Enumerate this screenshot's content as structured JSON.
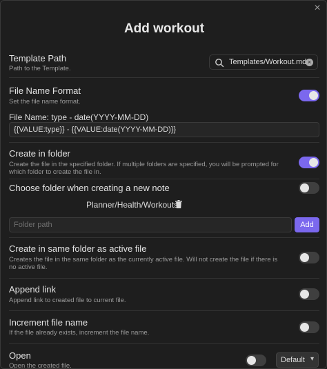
{
  "modal": {
    "title": "Add workout"
  },
  "template_path": {
    "title": "Template Path",
    "desc": "Path to the Template.",
    "value": "Templates/Workout.md"
  },
  "file_name_format": {
    "title": "File Name Format",
    "desc": "Set the file name format.",
    "enabled": true,
    "preview_label": "File Name: type - date(YYYY-MM-DD)",
    "value": "{{VALUE:type}} - {{VALUE:date(YYYY-MM-DD)}}"
  },
  "create_in_folder": {
    "title": "Create in folder",
    "desc_line1": "Create the file in the specified folder. If multiple folders are specified, you will be prompted for",
    "desc_line2": "which folder to create the file in.",
    "enabled": true
  },
  "choose_folder": {
    "title": "Choose folder when creating a new note",
    "enabled": false,
    "folders": [
      "Planner/Health/Workouts"
    ],
    "input_placeholder": "Folder path",
    "add_label": "Add"
  },
  "same_folder": {
    "title": "Create in same folder as active file",
    "desc_line1": "Creates the file in the same folder as the currently active file. Will not create the file if there is",
    "desc_line2": "no active file.",
    "enabled": false
  },
  "append_link": {
    "title": "Append link",
    "desc": "Append link to created file to current file.",
    "enabled": false
  },
  "increment": {
    "title": "Increment file name",
    "desc": "If the file already exists, increment the file name.",
    "enabled": false
  },
  "open": {
    "title": "Open",
    "desc": "Open the created file.",
    "enabled": false,
    "mode_value": "Default"
  },
  "colors": {
    "accent": "#7b68ee",
    "background": "#1e1e1e"
  }
}
